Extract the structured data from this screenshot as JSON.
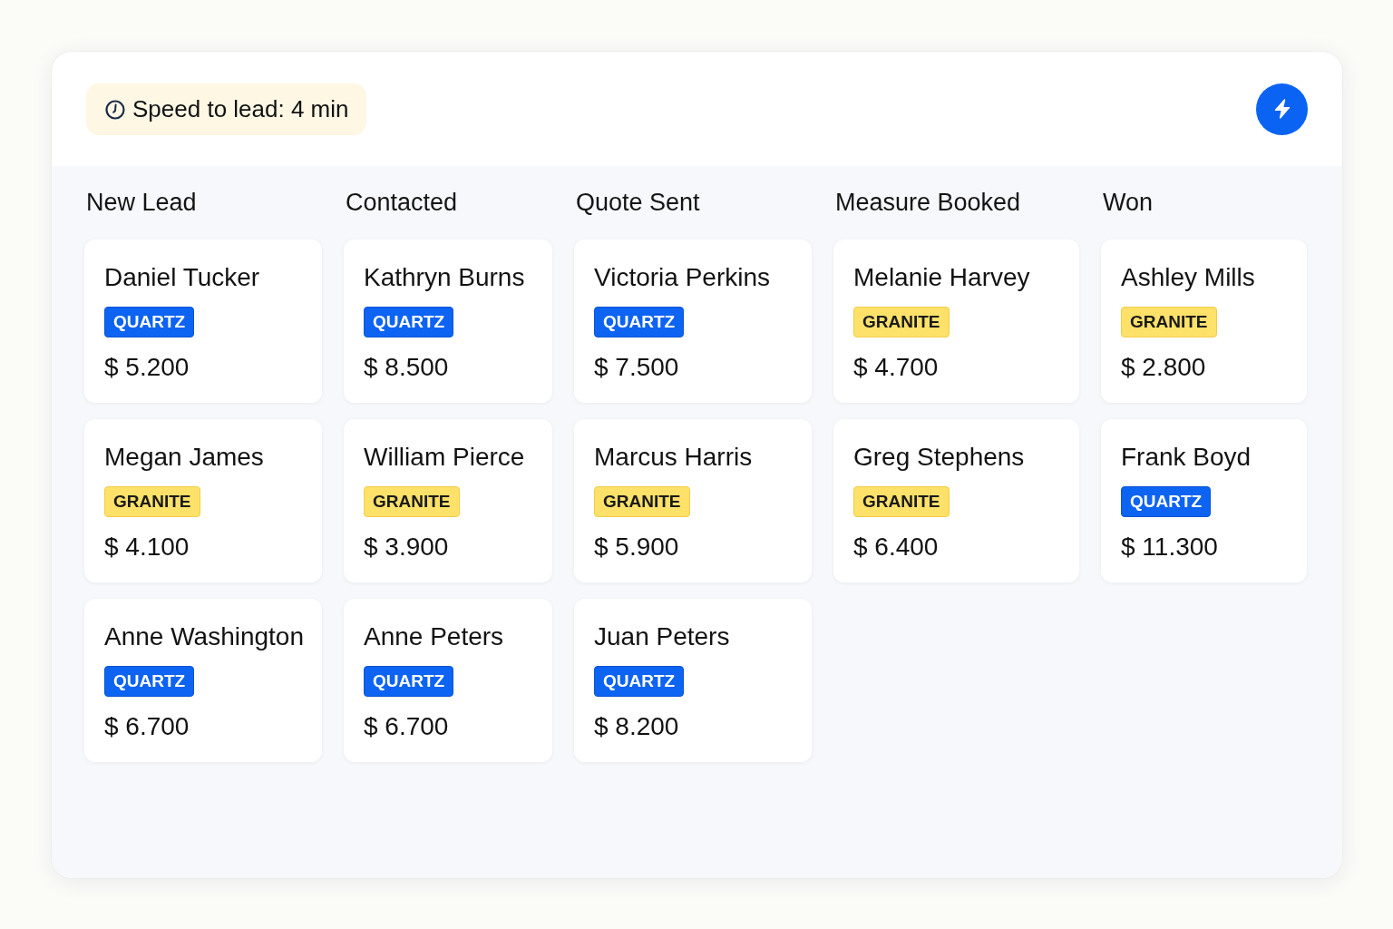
{
  "header": {
    "speed_to_lead": "Speed to lead: 4 min"
  },
  "columns": [
    {
      "title": "New Lead",
      "cards": [
        {
          "name": "Daniel Tucker",
          "tag": {
            "kind": "quartz",
            "label": "QUARTZ"
          },
          "amount": "$ 5.200"
        },
        {
          "name": "Megan James",
          "tag": {
            "kind": "granite",
            "label": "GRANITE"
          },
          "amount": "$ 4.100"
        },
        {
          "name": "Anne Washington",
          "tag": {
            "kind": "quartz",
            "label": "QUARTZ"
          },
          "amount": "$ 6.700"
        }
      ]
    },
    {
      "title": "Contacted",
      "cards": [
        {
          "name": "Kathryn Burns",
          "tag": {
            "kind": "quartz",
            "label": "QUARTZ"
          },
          "amount": "$ 8.500"
        },
        {
          "name": "William Pierce",
          "tag": {
            "kind": "granite",
            "label": "GRANITE"
          },
          "amount": "$ 3.900"
        },
        {
          "name": "Anne Peters",
          "tag": {
            "kind": "quartz",
            "label": "QUARTZ"
          },
          "amount": "$ 6.700"
        }
      ]
    },
    {
      "title": "Quote Sent",
      "cards": [
        {
          "name": "Victoria Perkins",
          "tag": {
            "kind": "quartz",
            "label": "QUARTZ"
          },
          "amount": "$ 7.500"
        },
        {
          "name": "Marcus Harris",
          "tag": {
            "kind": "granite",
            "label": "GRANITE"
          },
          "amount": "$ 5.900"
        },
        {
          "name": "Juan Peters",
          "tag": {
            "kind": "quartz",
            "label": "QUARTZ"
          },
          "amount": "$ 8.200"
        }
      ]
    },
    {
      "title": "Measure Booked",
      "cards": [
        {
          "name": "Melanie Harvey",
          "tag": {
            "kind": "granite",
            "label": "GRANITE"
          },
          "amount": "$ 4.700"
        },
        {
          "name": "Greg Stephens",
          "tag": {
            "kind": "granite",
            "label": "GRANITE"
          },
          "amount": "$ 6.400"
        }
      ]
    },
    {
      "title": "Won",
      "cards": [
        {
          "name": "Ashley Mills",
          "tag": {
            "kind": "granite",
            "label": "GRANITE"
          },
          "amount": "$ 2.800"
        },
        {
          "name": "Frank Boyd",
          "tag": {
            "kind": "quartz",
            "label": "QUARTZ"
          },
          "amount": "$ 11.300"
        }
      ]
    }
  ]
}
